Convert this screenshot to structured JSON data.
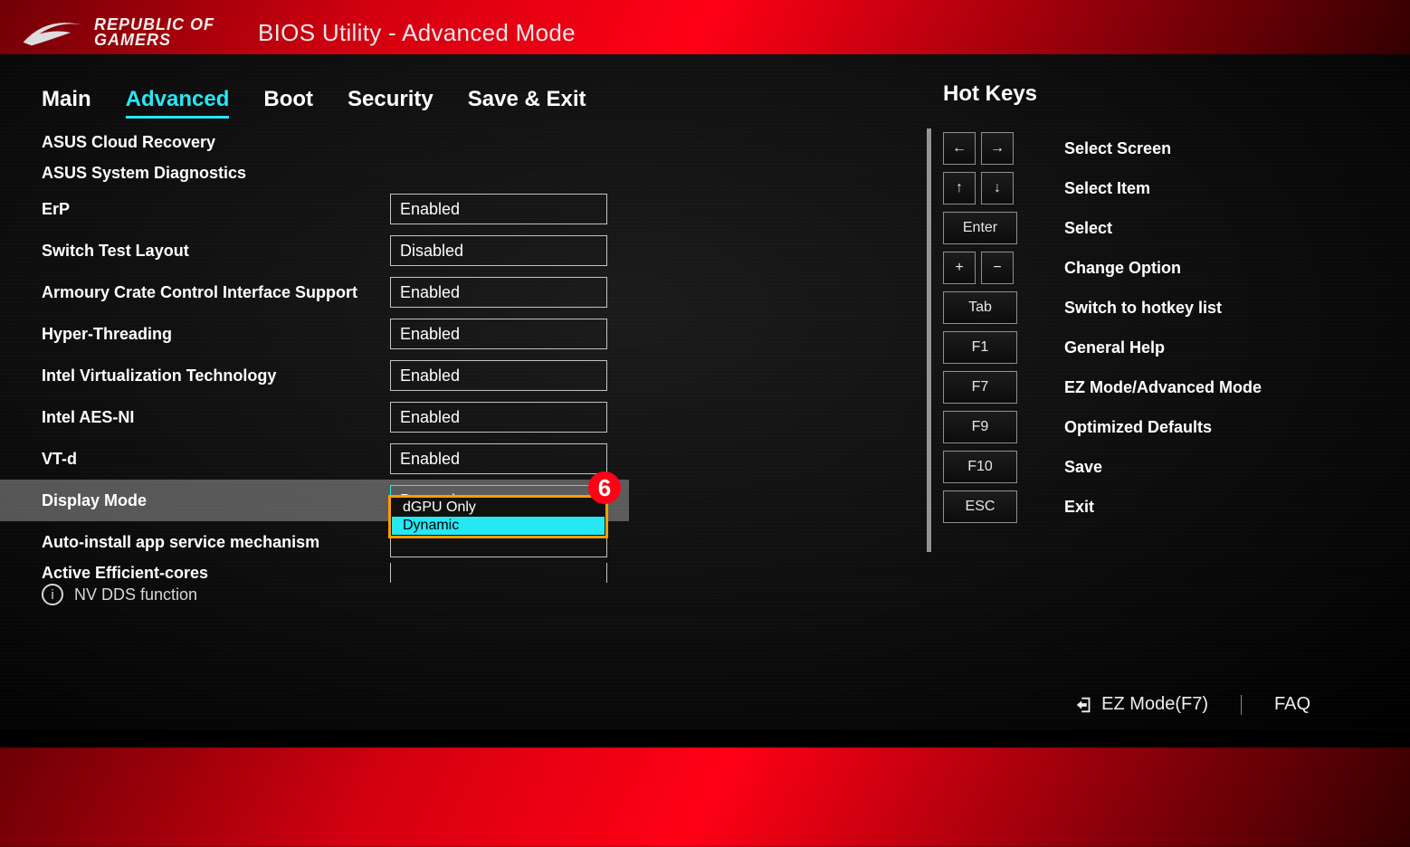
{
  "header": {
    "brand_top": "REPUBLIC OF",
    "brand_bot": "GAMERS",
    "app_title": "BIOS Utility - Advanced Mode"
  },
  "tabs": [
    "Main",
    "Advanced",
    "Boot",
    "Security",
    "Save & Exit"
  ],
  "active_tab": "Advanced",
  "panel": {
    "link_rows": [
      "ASUS Cloud Recovery",
      "ASUS System Diagnostics"
    ],
    "settings": [
      {
        "label": "ErP",
        "value": "Enabled"
      },
      {
        "label": "Switch Test Layout",
        "value": "Disabled"
      },
      {
        "label": "Armoury Crate Control Interface Support",
        "value": "Enabled"
      },
      {
        "label": "Hyper-Threading",
        "value": "Enabled"
      },
      {
        "label": "Intel Virtualization Technology",
        "value": "Enabled"
      },
      {
        "label": "Intel AES-NI",
        "value": "Enabled"
      },
      {
        "label": "VT-d",
        "value": "Enabled"
      },
      {
        "label": "Display Mode",
        "value": "Dynamic",
        "selected": true
      },
      {
        "label": "Auto-install app service mechanism",
        "value": ""
      },
      {
        "label": "Active Efficient-cores",
        "value": "",
        "cutoff": true
      }
    ],
    "dropdown": {
      "options": [
        "dGPU Only",
        "Dynamic"
      ],
      "selected": "Dynamic"
    },
    "annotation": "6",
    "footnote": "NV DDS function"
  },
  "sidebar": {
    "title": "Hot Keys",
    "items": [
      {
        "keys": [
          "←",
          "→"
        ],
        "label": "Select Screen"
      },
      {
        "keys": [
          "↑",
          "↓"
        ],
        "label": "Select Item"
      },
      {
        "keys": [
          "Enter"
        ],
        "wide": true,
        "label": "Select"
      },
      {
        "keys": [
          "+",
          "−"
        ],
        "label": "Change Option"
      },
      {
        "keys": [
          "Tab"
        ],
        "wide": true,
        "label": "Switch to hotkey list"
      },
      {
        "keys": [
          "F1"
        ],
        "wide": true,
        "label": "General Help"
      },
      {
        "keys": [
          "F7"
        ],
        "wide": true,
        "label": "EZ Mode/Advanced Mode"
      },
      {
        "keys": [
          "F9"
        ],
        "wide": true,
        "label": "Optimized Defaults"
      },
      {
        "keys": [
          "F10"
        ],
        "wide": true,
        "label": "Save"
      },
      {
        "keys": [
          "ESC"
        ],
        "wide": true,
        "label": "Exit"
      }
    ]
  },
  "bottombar": {
    "ezmode": "EZ Mode(F7)",
    "faq": "FAQ"
  }
}
